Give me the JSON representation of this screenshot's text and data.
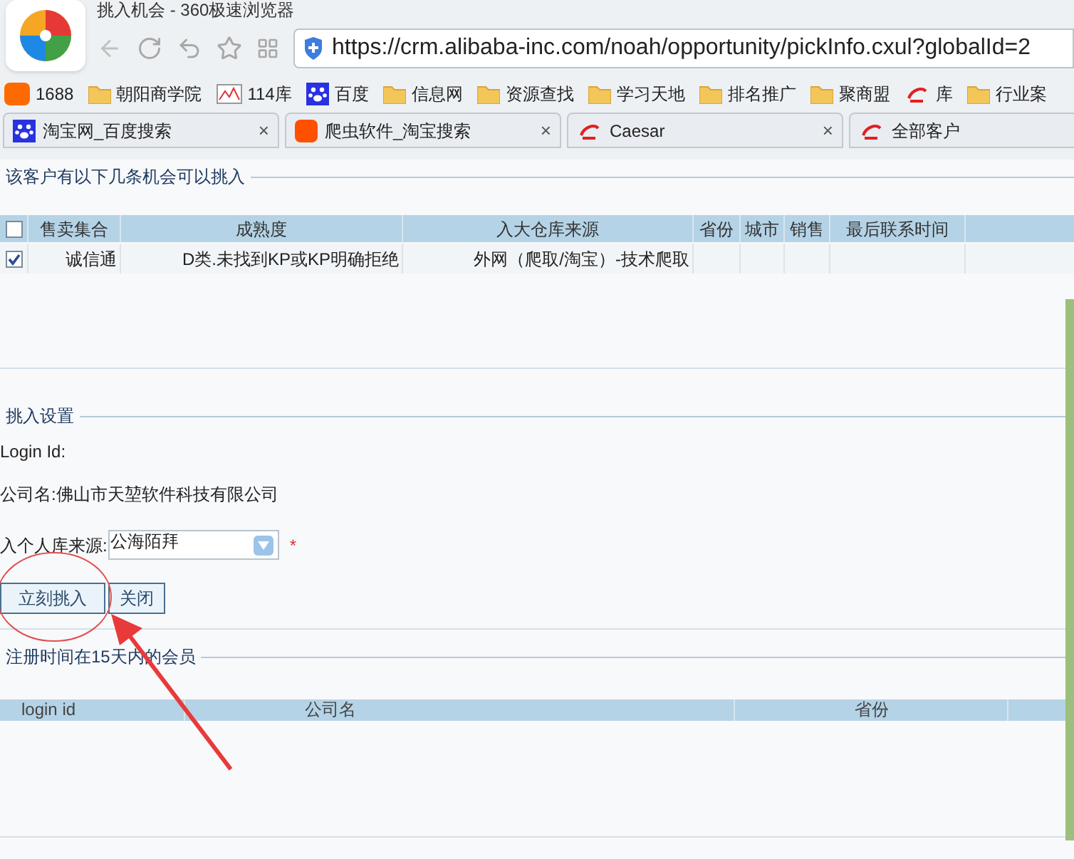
{
  "window": {
    "title": "挑入机会 - 360极速浏览器"
  },
  "address_bar": {
    "url": "https://crm.alibaba-inc.com/noah/opportunity/pickInfo.cxul?globalId=2"
  },
  "bookmarks": [
    {
      "label": "1688",
      "kind": "orange"
    },
    {
      "label": "朝阳商学院",
      "kind": "folder"
    },
    {
      "label": "114库",
      "kind": "chart"
    },
    {
      "label": "百度",
      "kind": "paw"
    },
    {
      "label": "信息网",
      "kind": "folder"
    },
    {
      "label": "资源查找",
      "kind": "folder"
    },
    {
      "label": "学习天地",
      "kind": "folder"
    },
    {
      "label": "排名推广",
      "kind": "folder"
    },
    {
      "label": "聚商盟",
      "kind": "folder"
    },
    {
      "label": "库",
      "kind": "ali"
    },
    {
      "label": "行业案",
      "kind": "folder"
    }
  ],
  "tabs": [
    {
      "label": "淘宝网_百度搜索",
      "kind": "paw",
      "selected": false,
      "close": "×"
    },
    {
      "label": "爬虫软件_淘宝搜索",
      "kind": "tao",
      "selected": false,
      "close": "×"
    },
    {
      "label": "Caesar",
      "kind": "ali",
      "selected": false,
      "close": "×"
    },
    {
      "label": "全部客户",
      "kind": "ali",
      "selected": false
    }
  ],
  "opportunities": {
    "title": "该客户有以下几条机会可以挑入",
    "select_all_checked": false,
    "columns": [
      "售卖集合",
      "成熟度",
      "入大仓库来源",
      "省份",
      "城市",
      "销售",
      "最后联系时间"
    ],
    "rows": [
      {
        "checked": true,
        "cells": [
          "诚信通",
          "D类.未找到KP或KP明确拒绝",
          "外网（爬取/淘宝）-技术爬取",
          "",
          "",
          "",
          ""
        ]
      }
    ]
  },
  "settings": {
    "title": "挑入设置",
    "login_id": "Login Id:",
    "company": "公司名:佛山市天堃软件科技有限公司",
    "source_label": "入个人库来源:",
    "source_value": "公海陌拜",
    "required": "*",
    "buttons": [
      "立刻挑入",
      "关闭"
    ]
  },
  "members": {
    "title": "注册时间在15天内的会员",
    "columns": [
      "login id",
      "公司名",
      "省份"
    ]
  }
}
